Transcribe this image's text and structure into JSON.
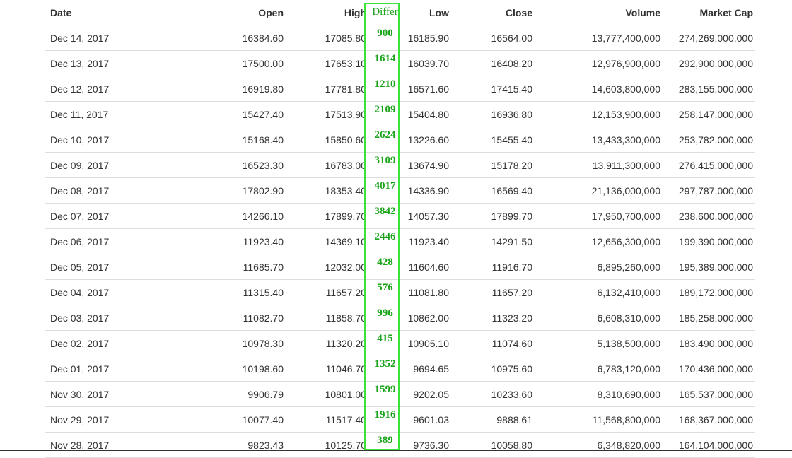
{
  "table": {
    "headers": {
      "date": "Date",
      "open": "Open",
      "high": "High",
      "differ": "Differ",
      "low": "Low",
      "close": "Close",
      "volume": "Volume",
      "market_cap": "Market Cap"
    },
    "rows": [
      {
        "date": "Dec 14, 2017",
        "open": "16384.60",
        "high": "17085.80",
        "differ": "900",
        "low": "16185.90",
        "close": "16564.00",
        "volume": "13,777,400,000",
        "market_cap": "274,269,000,000"
      },
      {
        "date": "Dec 13, 2017",
        "open": "17500.00",
        "high": "17653.10",
        "differ": "1614",
        "low": "16039.70",
        "close": "16408.20",
        "volume": "12,976,900,000",
        "market_cap": "292,900,000,000"
      },
      {
        "date": "Dec 12, 2017",
        "open": "16919.80",
        "high": "17781.80",
        "differ": "1210",
        "low": "16571.60",
        "close": "17415.40",
        "volume": "14,603,800,000",
        "market_cap": "283,155,000,000"
      },
      {
        "date": "Dec 11, 2017",
        "open": "15427.40",
        "high": "17513.90",
        "differ": "2109",
        "low": "15404.80",
        "close": "16936.80",
        "volume": "12,153,900,000",
        "market_cap": "258,147,000,000"
      },
      {
        "date": "Dec 10, 2017",
        "open": "15168.40",
        "high": "15850.60",
        "differ": "2624",
        "low": "13226.60",
        "close": "15455.40",
        "volume": "13,433,300,000",
        "market_cap": "253,782,000,000"
      },
      {
        "date": "Dec 09, 2017",
        "open": "16523.30",
        "high": "16783.00",
        "differ": "3109",
        "low": "13674.90",
        "close": "15178.20",
        "volume": "13,911,300,000",
        "market_cap": "276,415,000,000"
      },
      {
        "date": "Dec 08, 2017",
        "open": "17802.90",
        "high": "18353.40",
        "differ": "4017",
        "low": "14336.90",
        "close": "16569.40",
        "volume": "21,136,000,000",
        "market_cap": "297,787,000,000"
      },
      {
        "date": "Dec 07, 2017",
        "open": "14266.10",
        "high": "17899.70",
        "differ": "3842",
        "low": "14057.30",
        "close": "17899.70",
        "volume": "17,950,700,000",
        "market_cap": "238,600,000,000"
      },
      {
        "date": "Dec 06, 2017",
        "open": "11923.40",
        "high": "14369.10",
        "differ": "2446",
        "low": "11923.40",
        "close": "14291.50",
        "volume": "12,656,300,000",
        "market_cap": "199,390,000,000"
      },
      {
        "date": "Dec 05, 2017",
        "open": "11685.70",
        "high": "12032.00",
        "differ": "428",
        "low": "11604.60",
        "close": "11916.70",
        "volume": "6,895,260,000",
        "market_cap": "195,389,000,000"
      },
      {
        "date": "Dec 04, 2017",
        "open": "11315.40",
        "high": "11657.20",
        "differ": "576",
        "low": "11081.80",
        "close": "11657.20",
        "volume": "6,132,410,000",
        "market_cap": "189,172,000,000"
      },
      {
        "date": "Dec 03, 2017",
        "open": "11082.70",
        "high": "11858.70",
        "differ": "996",
        "low": "10862.00",
        "close": "11323.20",
        "volume": "6,608,310,000",
        "market_cap": "185,258,000,000"
      },
      {
        "date": "Dec 02, 2017",
        "open": "10978.30",
        "high": "11320.20",
        "differ": "415",
        "low": "10905.10",
        "close": "11074.60",
        "volume": "5,138,500,000",
        "market_cap": "183,490,000,000"
      },
      {
        "date": "Dec 01, 2017",
        "open": "10198.60",
        "high": "11046.70",
        "differ": "1352",
        "low": "9694.65",
        "close": "10975.60",
        "volume": "6,783,120,000",
        "market_cap": "170,436,000,000"
      },
      {
        "date": "Nov 30, 2017",
        "open": "9906.79",
        "high": "10801.00",
        "differ": "1599",
        "low": "9202.05",
        "close": "10233.60",
        "volume": "8,310,690,000",
        "market_cap": "165,537,000,000"
      },
      {
        "date": "Nov 29, 2017",
        "open": "10077.40",
        "high": "11517.40",
        "differ": "1916",
        "low": "9601.03",
        "close": "9888.61",
        "volume": "11,568,800,000",
        "market_cap": "168,367,000,000"
      },
      {
        "date": "Nov 28, 2017",
        "open": "9823.43",
        "high": "10125.70",
        "differ": "389",
        "low": "9736.30",
        "close": "10058.80",
        "volume": "6,348,820,000",
        "market_cap": "164,104,000,000"
      }
    ]
  },
  "colors": {
    "highlight_border": "#3ae23a",
    "differ_text": "#1aa31a",
    "row_divider": "#dddddd"
  }
}
